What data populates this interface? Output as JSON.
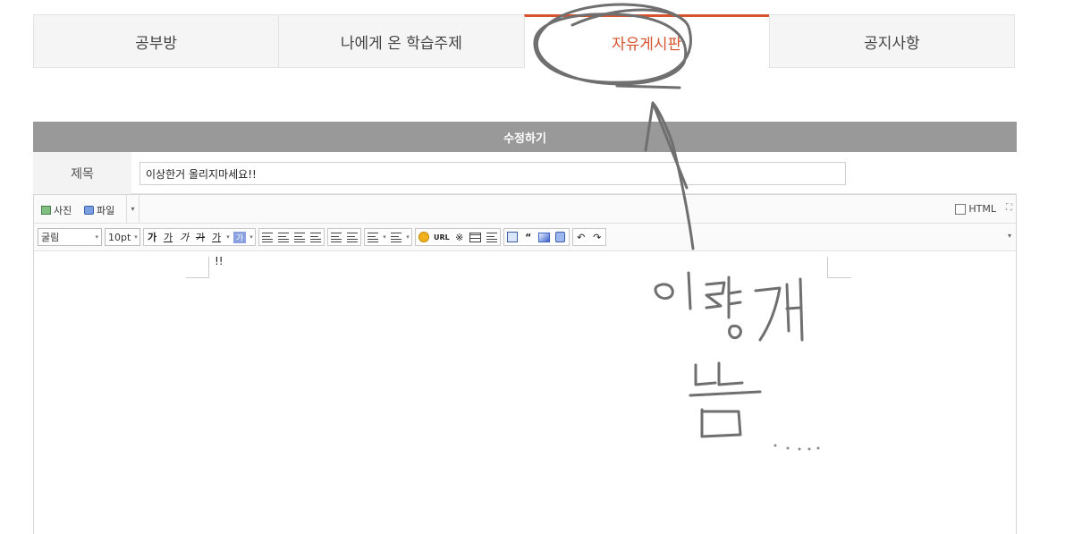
{
  "tabs": [
    {
      "label": "공부방",
      "active": false
    },
    {
      "label": "나에게 온 학습주제",
      "active": false
    },
    {
      "label": "자유게시판",
      "active": true
    },
    {
      "label": "공지사항",
      "active": false
    }
  ],
  "form": {
    "header": "수정하기",
    "title_label": "제목",
    "title_value": "이상한거 올리지마세요!!"
  },
  "editor": {
    "attach_photo": "사진",
    "attach_file": "파일",
    "html_label": "HTML",
    "font_family": "굴림",
    "font_size": "10pt",
    "url_label": "URL",
    "body_text": "!!"
  },
  "toolbar_glyphs": {
    "bold": "가",
    "underline": "가",
    "italic": "가",
    "strike": "가",
    "font_color": "가",
    "bg_color": "가",
    "symbol": "※",
    "quote": "“",
    "undo": "↶",
    "redo": "↷"
  },
  "colors": {
    "accent": "#d5532e",
    "header_bar": "#999999",
    "handwriting": "#6f6f6f"
  },
  "annotation_note": "이렇게 뜸....."
}
